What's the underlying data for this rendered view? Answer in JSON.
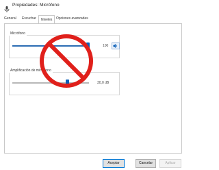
{
  "window": {
    "title": "Propiedades: Micrófono"
  },
  "tabs": [
    {
      "label": "General"
    },
    {
      "label": "Escuchar"
    },
    {
      "label": "Niveles"
    },
    {
      "label": "Opciones avanzadas"
    }
  ],
  "levels": {
    "microphone": {
      "label": "Micrófono",
      "value": "100",
      "level": 100
    },
    "boost": {
      "label": "Amplificación de micrófono",
      "value": "30,0 dB",
      "level": 30
    }
  },
  "buttons": {
    "ok": "Aceptar",
    "cancel": "Cancelar",
    "apply": "Aplicar"
  },
  "overlay": {
    "icon": "prohibited-icon",
    "color": "#e0201b"
  },
  "colors": {
    "accent": "#0a5fb8"
  }
}
